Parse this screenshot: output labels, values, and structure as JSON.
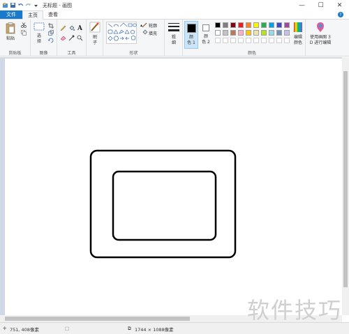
{
  "window": {
    "title": "无标题 - 画图",
    "controls": [
      "—",
      "☐",
      "✕"
    ]
  },
  "tabs": [
    {
      "label": "文件"
    },
    {
      "label": "主页"
    },
    {
      "label": "查看"
    }
  ],
  "ribbon": {
    "clipboard": {
      "paste_label": "粘贴",
      "group_label": "剪贴板"
    },
    "image": {
      "select_label": "选\n择",
      "group_label": "图像"
    },
    "tools": {
      "group_label": "工具"
    },
    "brushes": {
      "label": "刷\n子"
    },
    "shapes": {
      "outline_label": "轮廓",
      "fill_label": "填充",
      "group_label": "形状"
    },
    "size": {
      "label": "粗\n细"
    },
    "color1": {
      "label": "颜\n色 1"
    },
    "color2": {
      "label": "颜\n色 2"
    },
    "colors": {
      "group_label": "颜色"
    },
    "edit_colors": {
      "label": "编辑\n颜色"
    },
    "paint3d": {
      "label": "使用画图 3\nD 进行编辑"
    }
  },
  "palette": {
    "row1": [
      "#000000",
      "#7f7f7f",
      "#880015",
      "#ed1c24",
      "#ff7f27",
      "#fff200",
      "#22b14c",
      "#00a2e8",
      "#3f48cc",
      "#a349a4"
    ],
    "row2": [
      "#ffffff",
      "#c3c3c3",
      "#b97a57",
      "#ffaec9",
      "#ffc90e",
      "#efe4b0",
      "#b5e61d",
      "#99d9ea",
      "#7092be",
      "#c8bfe7"
    ],
    "row3": [
      "#ffffff",
      "#ffffff",
      "#ffffff",
      "#ffffff",
      "#ffffff",
      "#ffffff",
      "#ffffff",
      "#ffffff",
      "#ffffff",
      "#ffffff"
    ]
  },
  "colors": {
    "color1": "#000000",
    "color2": "#ffffff",
    "accent": "#1979ca"
  },
  "status": {
    "cursor_position": "751, 408像素",
    "canvas_size": "1744 × 1088像素"
  },
  "watermark": "软件技巧"
}
